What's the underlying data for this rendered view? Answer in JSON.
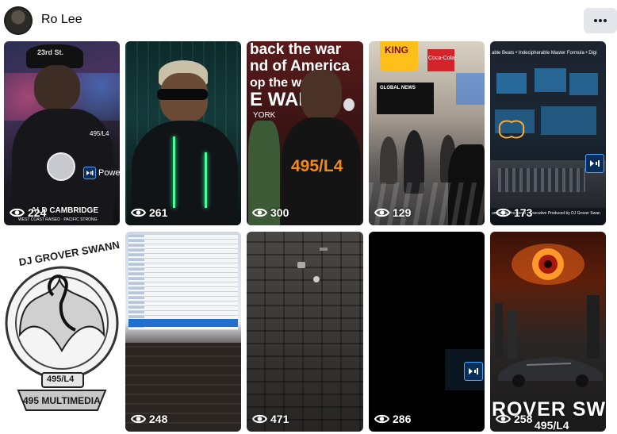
{
  "profile": {
    "name": "Ro Lee"
  },
  "header": {
    "more_icon": "more-horizontal-icon"
  },
  "tiles": [
    {
      "views": "224",
      "caption": "ALD CAMBRIDGE",
      "subcaption": "WEST COAST RAISED · PACIFIC STRONG",
      "badge": "Power",
      "hat_text": "23rd St.",
      "chain_text": "495/L4"
    },
    {
      "views": "261"
    },
    {
      "views": "300",
      "poster_line1": "back the war",
      "poster_line2": "nd of America",
      "poster_line3": "op the war -",
      "poster_line4": "E WAR T",
      "poster_line5": "YORK",
      "shirt_text": "495/L4"
    },
    {
      "views": "129",
      "sign1": "KING",
      "sign2": "Coca-Cola",
      "sign3": "GLOBAL NEWS"
    },
    {
      "views": "173",
      "banner": "able Beats • Indecipherable Master Formula • Digi",
      "footer": "umentals Produced • Executive Produced by DJ Grover Swan"
    },
    {
      "views": "",
      "logo_top": "DJ GROVER SWANN",
      "logo_mid": "495/L4",
      "logo_bottom": "495 MULTIMEDIA"
    },
    {
      "views": "248"
    },
    {
      "views": "471"
    },
    {
      "views": "286"
    },
    {
      "views": "258",
      "big_text": "ROVER SW",
      "small_text": "495/L4"
    }
  ],
  "colors": {
    "accent_blue": "#49a6ff",
    "button_bg": "#e4e6eb",
    "text": "#050505"
  }
}
